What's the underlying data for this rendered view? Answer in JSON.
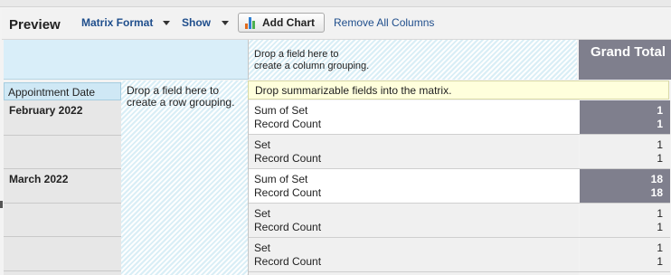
{
  "toolbar": {
    "title": "Preview",
    "format_label": "Matrix Format",
    "show_label": "Show",
    "add_chart_label": "Add Chart",
    "remove_columns_label": "Remove All Columns"
  },
  "matrix": {
    "column_drop_text_1": "Drop a field here to",
    "column_drop_text_2": "create a column grouping.",
    "grand_total_label": "Grand Total",
    "row_header": "Appointment Date",
    "row_drop_text_1": "Drop a field here to",
    "row_drop_text_2": "create a row grouping.",
    "summarize_hint": "Drop summarizable fields into the matrix.",
    "months": [
      "February 2022",
      "March 2022"
    ],
    "rows": [
      {
        "label1": "Sum of Set",
        "label2": "Record Count",
        "val1": "1",
        "val2": "1"
      },
      {
        "label1": "Set",
        "label2": "Record Count",
        "val1": "1",
        "val2": "1"
      },
      {
        "label1": "Sum of Set",
        "label2": "Record Count",
        "val1": "18",
        "val2": "18"
      },
      {
        "label1": "Set",
        "label2": "Record Count",
        "val1": "1",
        "val2": "1"
      },
      {
        "label1": "Set",
        "label2": "Record Count",
        "val1": "1",
        "val2": "1"
      }
    ]
  },
  "colors": {
    "grand_total_bg": "#7f7f8d",
    "header_band": "#d9eef9",
    "hint_bg": "#ffffdc",
    "link": "#1f4e8c"
  }
}
